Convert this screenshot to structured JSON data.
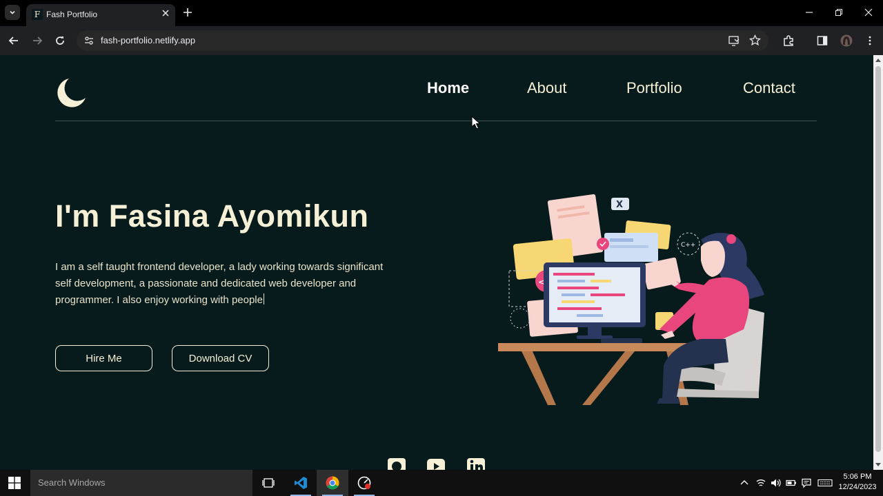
{
  "browser": {
    "tab_title": "Fash Portfolio",
    "tab_favicon_letter": "F",
    "url": "fash-portfolio.netlify.app"
  },
  "site": {
    "nav": [
      {
        "label": "Home",
        "active": true
      },
      {
        "label": "About",
        "active": false
      },
      {
        "label": "Portfolio",
        "active": false
      },
      {
        "label": "Contact",
        "active": false
      }
    ],
    "hero_title": "I'm Fasina Ayomikun",
    "hero_text": "I am a self taught frontend developer, a lady working towards significant self development, a passionate and dedicated web developer and programmer. I also enjoy working with people",
    "buttons": {
      "hire": "Hire Me",
      "download": "Download CV"
    },
    "illustration_labels": {
      "cpp": "C++",
      "code": "</>",
      "close": "X"
    },
    "social_icons": [
      "github-icon",
      "youtube-icon",
      "linkedin-icon"
    ],
    "colors": {
      "background": "#071a1c",
      "text": "#f6f1d6",
      "accent_pink": "#e8467c",
      "accent_yellow": "#f7d774"
    }
  },
  "taskbar": {
    "search_placeholder": "Search Windows",
    "time": "5:06 PM",
    "date": "12/24/2023"
  }
}
